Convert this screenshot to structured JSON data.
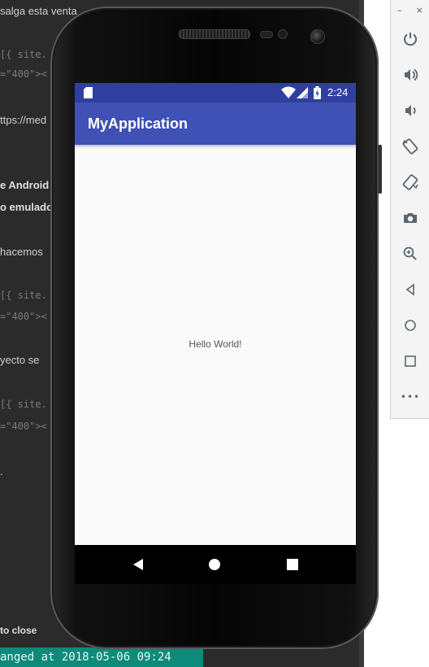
{
  "editor": {
    "lines": [
      {
        "text": "salga esta venta",
        "style": "normal"
      },
      {
        "text": "[{ site.",
        "style": "mono"
      },
      {
        "text": "=\"400\"><",
        "style": "mono"
      },
      {
        "text": "ttps://med",
        "style": "normal"
      },
      {
        "text": "e Android",
        "style": "bold"
      },
      {
        "text": "o emulado",
        "style": "bold"
      },
      {
        "text": "hacemos",
        "style": "normal"
      },
      {
        "text": "[{ site.",
        "style": "mono"
      },
      {
        "text": "=\"400\"><",
        "style": "mono"
      },
      {
        "text": "yecto se",
        "style": "normal"
      },
      {
        "text": "[{ site.",
        "style": "mono"
      },
      {
        "text": "=\"400\"><",
        "style": "mono"
      },
      {
        "text": ".",
        "style": "normal"
      },
      {
        "text": "to close",
        "style": "bold"
      }
    ],
    "status_text": "anged at 2018-05-06 09:24"
  },
  "toolbar": {
    "minimize_label": "–",
    "close_label": "×",
    "buttons": [
      {
        "name": "power-icon"
      },
      {
        "name": "volume-up-icon"
      },
      {
        "name": "volume-down-icon"
      },
      {
        "name": "rotate-left-icon"
      },
      {
        "name": "rotate-right-icon"
      },
      {
        "name": "camera-icon"
      },
      {
        "name": "zoom-icon"
      },
      {
        "name": "back-icon"
      },
      {
        "name": "home-icon"
      },
      {
        "name": "overview-icon"
      },
      {
        "name": "more-icon"
      }
    ],
    "more_label": "•••"
  },
  "phone": {
    "status_time": "2:24",
    "app_title": "MyApplication",
    "content_text": "Hello World!"
  },
  "colors": {
    "status_bar": "#303f9f",
    "app_bar": "#3f51b5",
    "screen_bg": "#fafafa",
    "editor_bg": "#2b2b2b",
    "status_strip": "#0e8a7a"
  }
}
